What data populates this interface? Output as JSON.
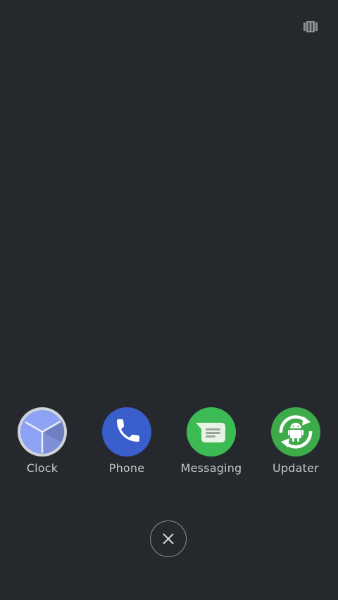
{
  "header": {
    "toggle_icon": "view-toggle-icon"
  },
  "apps": [
    {
      "label": "Clock",
      "icon": "clock-icon",
      "color": "#8ea2f5"
    },
    {
      "label": "Phone",
      "icon": "phone-icon",
      "color": "#3a5fcd"
    },
    {
      "label": "Messaging",
      "icon": "messaging-icon",
      "color": "#3cba54"
    },
    {
      "label": "Updater",
      "icon": "updater-icon",
      "color": "#3dab4a"
    }
  ],
  "close_button": {
    "icon": "close-icon"
  }
}
